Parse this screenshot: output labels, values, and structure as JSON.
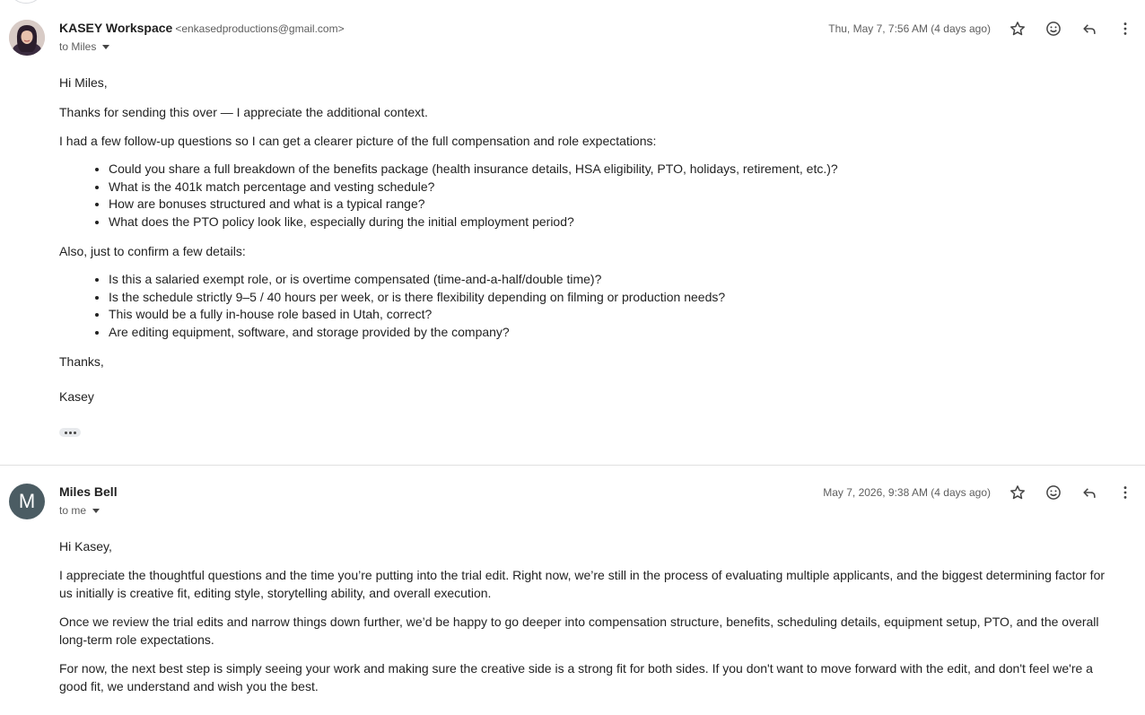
{
  "messages": [
    {
      "sender_name": "KASEY Workspace",
      "sender_email": "<enkasedproductions@gmail.com>",
      "to_label": "to Miles",
      "date": "Thu, May 7, 7:56 AM (4 days ago)",
      "avatar": "photo-avatar",
      "greeting": "Hi Miles,",
      "para1": "Thanks for sending this over — I appreciate the additional context.",
      "para2": "I had a few follow-up questions so I can get a clearer picture of the full compensation and role expectations:",
      "list1": [
        "Could you share a full breakdown of the benefits package (health insurance details, HSA eligibility, PTO, holidays, retirement, etc.)?",
        "What is the 401k match percentage and vesting schedule?",
        "How are bonuses structured and what is a typical range?",
        "What does the PTO policy look like, especially during the initial employment period?"
      ],
      "para3": "Also, just to confirm a few details:",
      "list2": [
        "Is this a salaried exempt role, or is overtime compensated (time-and-a-half/double time)?",
        "Is the schedule strictly 9–5 / 40 hours per week, or is there flexibility depending on filming or production needs?",
        "This would be a fully in-house role based in Utah, correct?",
        "Are editing equipment, software, and storage provided by the company?"
      ],
      "signoff": "Thanks,",
      "signature": "Kasey"
    },
    {
      "sender_name": "Miles Bell",
      "avatar_letter": "M",
      "to_label": "to me",
      "date": "May 7, 2026, 9:38 AM (4 days ago)",
      "greeting": "Hi Kasey,",
      "para1": "I appreciate the thoughtful questions and the time you’re putting into the trial edit. Right now, we’re still in the process of evaluating multiple applicants, and the biggest determining factor for us initially is creative fit, editing style, storytelling ability, and overall execution.",
      "para2": "Once we review the trial edits and narrow things down further, we’d be happy to go deeper into compensation structure, benefits, scheduling details, equipment setup, PTO, and the overall long-term role expectations.",
      "para3": "For now, the next best step is simply seeing your work and making sure the creative side is a strong fit for both sides. If you don't want to move forward with the edit, and don't feel we're a good fit, we understand and wish you the best."
    }
  ],
  "icons": {
    "star": "star-icon",
    "emoji": "emoji-icon",
    "reply": "reply-icon",
    "more": "more-vert-icon",
    "expand": "ellipsis-icon"
  }
}
